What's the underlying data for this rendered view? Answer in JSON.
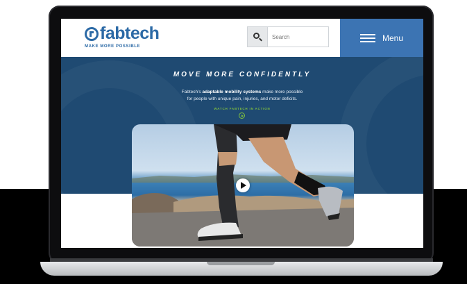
{
  "site": {
    "logo_text": "fabtech",
    "tagline": "MAKE MORE POSSIBLE",
    "search": {
      "placeholder": "Search"
    },
    "menu_label": "Menu"
  },
  "hero": {
    "title": "MOVE MORE CONFIDENTLY",
    "subtitle_prefix": "Fabtech's ",
    "subtitle_bold": "adaptable mobility systems",
    "subtitle_line1_suffix": " make more possible",
    "subtitle_line2": "for people with unique pain, injuries, and motor deficits.",
    "cta_label": "WATCH FABTECH IN ACTION"
  },
  "colors": {
    "brand_blue": "#2c6aa6",
    "hero_navy": "#1f4a72",
    "menu_blue": "#3c74b3",
    "cta_green": "#7fbf3f"
  },
  "icons": [
    "search-icon",
    "hamburger-icon",
    "play-icon",
    "play-circle-icon"
  ]
}
